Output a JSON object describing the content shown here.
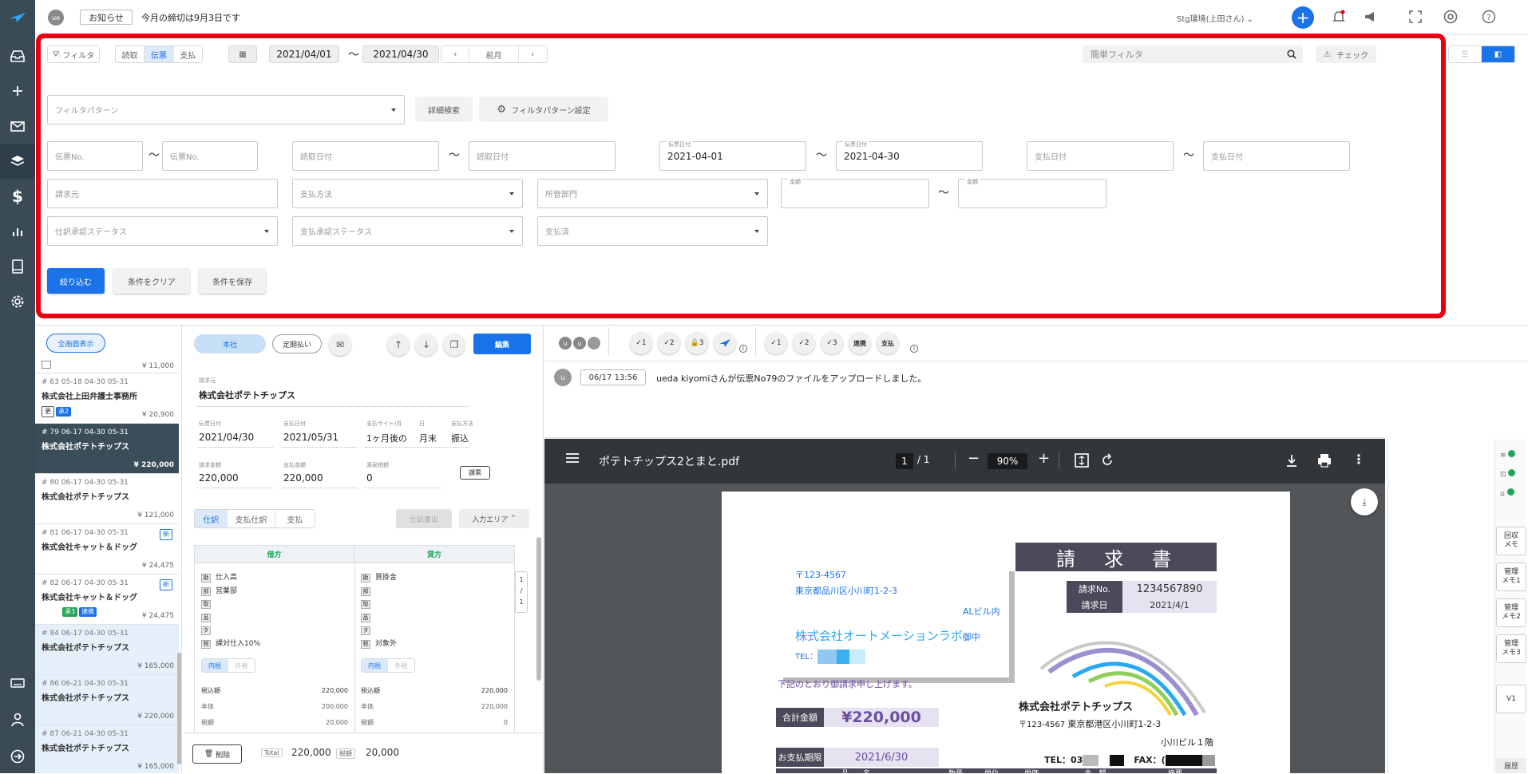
{
  "topbar": {
    "avatar": "ue",
    "notice_label": "お知らせ",
    "notice_text": "今月の締切は9月3日です",
    "env_label": "Stg環境(上田さん)"
  },
  "filter": {
    "filter_button": "フィルタ",
    "mode_tabs": [
      "読取",
      "伝票",
      "支払"
    ],
    "date_from": "2021/04/01",
    "date_to": "2021/04/30",
    "range_sep": "〜",
    "prev_month": "前月",
    "simple_filter_placeholder": "簡単フィルタ",
    "check_label": "チェック",
    "pattern_placeholder": "フィルタパターン",
    "detail_search": "詳細検索",
    "pattern_settings": "フィルタパターン設定",
    "slip_no_ph": "伝票No.",
    "read_date_ph": "読取日付",
    "slip_date_caption": "伝票日付",
    "slip_date_from": "2021-04-01",
    "slip_date_to": "2021-04-30",
    "pay_date_ph": "支払日付",
    "biller_ph": "請求元",
    "pay_method_ph": "支払方法",
    "dept_ph": "所管部門",
    "amount_caption": "金額",
    "journal_status_ph": "仕訳承認ステータス",
    "pay_status_ph": "支払承認ステータス",
    "paid_ph": "支払済",
    "apply_button": "絞り込む",
    "clear_button": "条件をクリア",
    "save_button": "条件を保存"
  },
  "list": {
    "show_all": "全画面表示",
    "top_amount": "¥ 11,000",
    "items": [
      {
        "meta": "# 63 05-18 04-30 05-31",
        "name": "株式会社上田弁護士事務所",
        "amount": "¥ 20,900",
        "tags": [
          "更",
          "承2"
        ]
      },
      {
        "meta": "# 79 06-17 04-30 05-31",
        "name": "株式会社ポテトチップス",
        "amount": "¥ 220,000",
        "tags": []
      },
      {
        "meta": "# 80 06-17 04-30 05-31",
        "name": "株式会社ポテトチップス",
        "amount": "¥ 121,000",
        "tags": []
      },
      {
        "meta": "# 81 06-17 04-30 05-31",
        "name": "株式会社キャット＆ドッグ",
        "amount": "¥ 24,475",
        "tags": [],
        "badge": "新"
      },
      {
        "meta": "# 82 06-17 04-30 05-31",
        "name": "株式会社キャット＆ドッグ",
        "amount": "¥ 24,475",
        "tags": [
          "承3",
          "連携"
        ],
        "badge": "新"
      },
      {
        "meta": "# 84 06-17 04-30 05-31",
        "name": "株式会社ポテトチップス",
        "amount": "¥ 165,000",
        "tags": []
      },
      {
        "meta": "# 86 06-21 04-30 05-31",
        "name": "株式会社ポテトチップス",
        "amount": "¥ 220,000",
        "tags": []
      },
      {
        "meta": "# 87 06-21 04-30 05-31",
        "name": "株式会社ポテトチップス",
        "amount": "¥ 165,000",
        "tags": []
      }
    ]
  },
  "detail": {
    "office_tab": "本社",
    "fixed_pay": "定期払い",
    "edit_button": "編集",
    "biller_label": "請求元",
    "biller": "株式会社ポテトチップス",
    "slip_date_label": "伝票日付",
    "slip_date": "2021/04/30",
    "pay_date_label": "支払日付",
    "pay_date": "2021/05/31",
    "site_label": "支払サイト/月",
    "site": "1ヶ月後の",
    "day_label": "日",
    "day": "月末",
    "method_label": "支払方法",
    "method": "振込",
    "bill_amount_label": "請求金額",
    "bill_amount": "220,000",
    "pay_amount_label": "支払金額",
    "pay_amount": "220,000",
    "withholding_label": "源泉税額",
    "withholding": "0",
    "tax_button": "課票",
    "tabs": [
      "仕訳",
      "支払仕訳",
      "支払"
    ],
    "journal_out": "仕訳書出",
    "input_area": "入力エリア",
    "debit_header": "借方",
    "credit_header": "貸方",
    "row_keys": [
      "勘",
      "部",
      "取",
      "品",
      "タ",
      "税"
    ],
    "debit_values": [
      "仕入高",
      "営業部",
      "",
      "",
      "",
      "課対仕入10%"
    ],
    "credit_values": [
      "買掛金",
      "",
      "",
      "",
      "",
      "対象外"
    ],
    "tax_in": "内税",
    "tax_out": "外税",
    "sum_labels": [
      "税込額",
      "本体",
      "税額"
    ],
    "debit_sums": [
      "220,000",
      "200,000",
      "20,000"
    ],
    "credit_sums": [
      "220,000",
      "220,000",
      "0"
    ],
    "pager": [
      "1",
      "/",
      "1"
    ],
    "delete_button": "削除",
    "total_label": "Total",
    "total": "220,000",
    "tax_label": "税額",
    "tax_total": "20,000"
  },
  "right": {
    "avatars": [
      "u",
      "u"
    ],
    "approvals_a": [
      "1",
      "2",
      "3"
    ],
    "approvals_b": [
      "1",
      "2",
      "3"
    ],
    "link_chip": "連携",
    "pay_chip": "支払",
    "log_time": "06/17 13:56",
    "log_text": "ueda kiyomiさんが伝票No79のファイルをアップロードしました。",
    "pdf_name": "ポテトチップス2とまと.pdf",
    "pdf_page": "1",
    "pdf_total": "/  1",
    "pdf_zoom": "90%",
    "side_chips": [
      "回収\nメモ",
      "管理\nメモ1",
      "管理\nメモ2",
      "管理\nメモ3"
    ],
    "version": "V1",
    "history": "履歴"
  },
  "invoice": {
    "title": "請　求　書",
    "zip": "〒123-4567",
    "addr": "東京都品川区小川町1-2-3",
    "bldg": "ALビル内",
    "company": "株式会社オートメーションラボ",
    "honorific": "御中",
    "tel": "TEL：",
    "no_label": "請求No.",
    "no": "1234567890",
    "date_label": "請求日",
    "date": "2021/4/1",
    "note": "下記のとおり御請求申し上げます。",
    "total_label": "合計金額",
    "total": "¥220,000",
    "due_label": "お支払期限",
    "due": "2021/6/30",
    "issuer": "株式会社ポテトチップス",
    "issuer_zip": "〒123-4567",
    "issuer_addr": "東京都港区小川町1-2-3",
    "issuer_bldg": "小川ビル１階",
    "issuer_tel": "TEL：03",
    "issuer_fax": "FAX：(",
    "table_headers": [
      "品　　名",
      "数量",
      "単位",
      "単価",
      "金　額",
      "摘要"
    ]
  },
  "colors": {
    "rail": "#3a4b56",
    "accent": "#1a73e8",
    "frame": "#e60012",
    "selected": "#3c4d5a",
    "invoice_header": "#4a4a5a"
  }
}
